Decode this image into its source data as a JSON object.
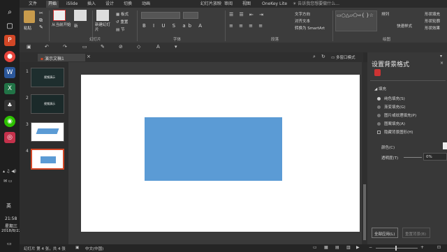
{
  "taskbar": {
    "time": "21:58",
    "weekday": "星期三",
    "date": "2018/8/22",
    "ime": "英"
  },
  "ribbon_tabs": [
    "文件",
    "开始",
    "iSlide",
    "插入",
    "设计",
    "切换",
    "动画",
    "幻灯片放映",
    "审阅",
    "视图",
    "OneKey Lite"
  ],
  "search_text": "告诉我您想要做什么...",
  "ribbon": {
    "paste": "粘贴",
    "from_current": "从当前开始",
    "new_slide": "新建幻灯片",
    "layout": "板式",
    "reset": "重置",
    "section": "节",
    "group_slides": "幻灯片",
    "group_font": "字体",
    "group_paragraph": "段落",
    "group_drawing": "绘图",
    "text_direction": "文字方向",
    "align_text": "对齐文本",
    "convert_smartart": "转换为 SmartArt",
    "arrange": "排列",
    "quick_styles": "快速样式",
    "shape_fill": "形状填充",
    "shape_outline": "形状轮廓",
    "shape_effects": "形状效果",
    "find": "查找",
    "replace": "替换",
    "select": "选择"
  },
  "doc_tab": "演示文稿1",
  "doc_tab_right": "多窗口模式",
  "thumbnails": [
    {
      "num": "1",
      "caption": "视频演示"
    },
    {
      "num": "2",
      "caption": "视频演示"
    },
    {
      "num": "3",
      "caption": ""
    },
    {
      "num": "4",
      "caption": ""
    }
  ],
  "panel": {
    "title": "设置背景格式",
    "section": "填充",
    "options": [
      "纯色填充(S)",
      "渐变填充(G)",
      "图片或纹理填充(P)",
      "图案填充(A)"
    ],
    "hide_bg": "隐藏背景图形(H)",
    "color_label": "颜色(C)",
    "transparency_label": "透明度(T)",
    "transparency_value": "0%",
    "apply_all": "全部应用(L)",
    "reset_bg": "重置背景(B)"
  },
  "status": {
    "slide_info": "幻灯片 第 4 张，共 4 张",
    "language": "中文(中国)"
  },
  "colors": {
    "accent": "#5b9bd5",
    "ribbon": "#3c3c3c"
  }
}
